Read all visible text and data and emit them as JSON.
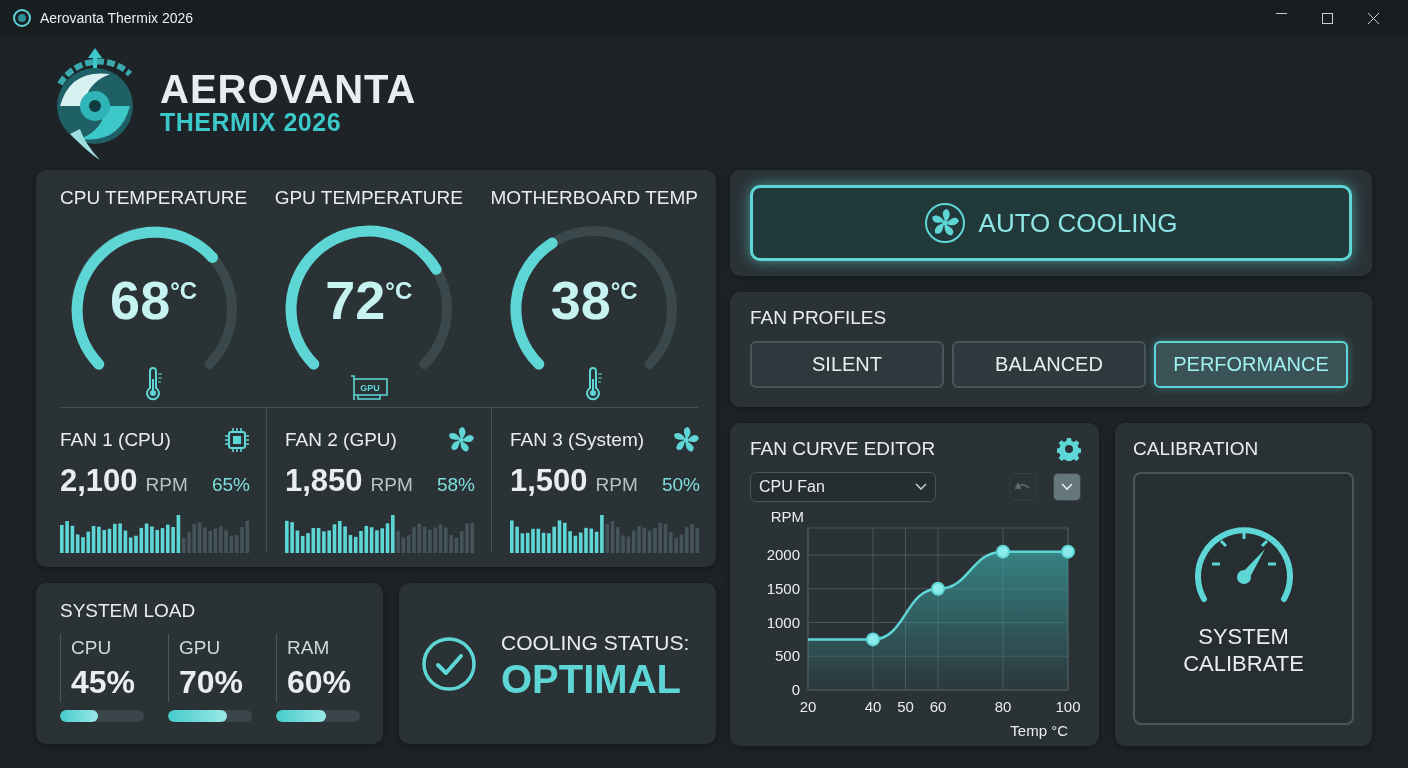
{
  "window": {
    "title": "Aerovanta Thermix 2026"
  },
  "brand": {
    "name": "AEROVANTA",
    "product": "THERMIX 2026"
  },
  "temperatures": [
    {
      "label": "CPU TEMPERATURE",
      "value": "68",
      "unit": "°C",
      "kind": "thermometer"
    },
    {
      "label": "GPU TEMPERATURE",
      "value": "72",
      "unit": "°C",
      "kind": "gpu",
      "icon_text": "GPU"
    },
    {
      "label": "MOTHERBOARD TEMP",
      "value": "38",
      "unit": "°C",
      "kind": "thermometer"
    }
  ],
  "fans": [
    {
      "name": "FAN 1 (CPU)",
      "kind": "chip",
      "rpm": "2,100",
      "unit": "RPM",
      "percent": "65%",
      "level": 0.65
    },
    {
      "name": "FAN 2 (GPU)",
      "kind": "fan",
      "rpm": "1,850",
      "unit": "RPM",
      "percent": "58%",
      "level": 0.58
    },
    {
      "name": "FAN 3 (System)",
      "kind": "fan",
      "rpm": "1,500",
      "unit": "RPM",
      "percent": "50%",
      "level": 0.5
    }
  ],
  "system_load": {
    "title": "SYSTEM LOAD",
    "items": [
      {
        "label": "CPU",
        "value": "45%",
        "level": 0.45
      },
      {
        "label": "GPU",
        "value": "70%",
        "level": 0.7
      },
      {
        "label": "RAM",
        "value": "60%",
        "level": 0.6
      }
    ]
  },
  "cooling_status": {
    "label": "COOLING STATUS:",
    "value": "OPTIMAL"
  },
  "auto_cooling": {
    "label": "AUTO COOLING",
    "active": true
  },
  "fan_profiles": {
    "title": "FAN PROFILES",
    "options": [
      {
        "label": "SILENT",
        "selected": false
      },
      {
        "label": "BALANCED",
        "selected": false
      },
      {
        "label": "PERFORMANCE",
        "selected": true
      }
    ]
  },
  "fan_curve": {
    "title": "FAN CURVE EDITOR",
    "fan_select": {
      "value": "CPU Fan"
    },
    "undo": {
      "disabled": true
    },
    "chart_data": {
      "type": "area",
      "xlabel": "Temp °C",
      "ylabel": "RPM",
      "x": [
        20,
        40,
        60,
        80,
        100
      ],
      "series": [
        {
          "color": "#5fd6d6",
          "values": [
            750,
            750,
            1500,
            2050,
            2050
          ]
        }
      ],
      "xticks": [
        20,
        40,
        50,
        60,
        80,
        100
      ],
      "yticks": [
        0,
        500,
        1000,
        1500,
        2000
      ],
      "xlim": [
        20,
        100
      ],
      "ylim": [
        0,
        2400
      ],
      "grid": true
    }
  },
  "calibration": {
    "title": "CALIBRATION",
    "button": "SYSTEM CALIBRATE"
  }
}
